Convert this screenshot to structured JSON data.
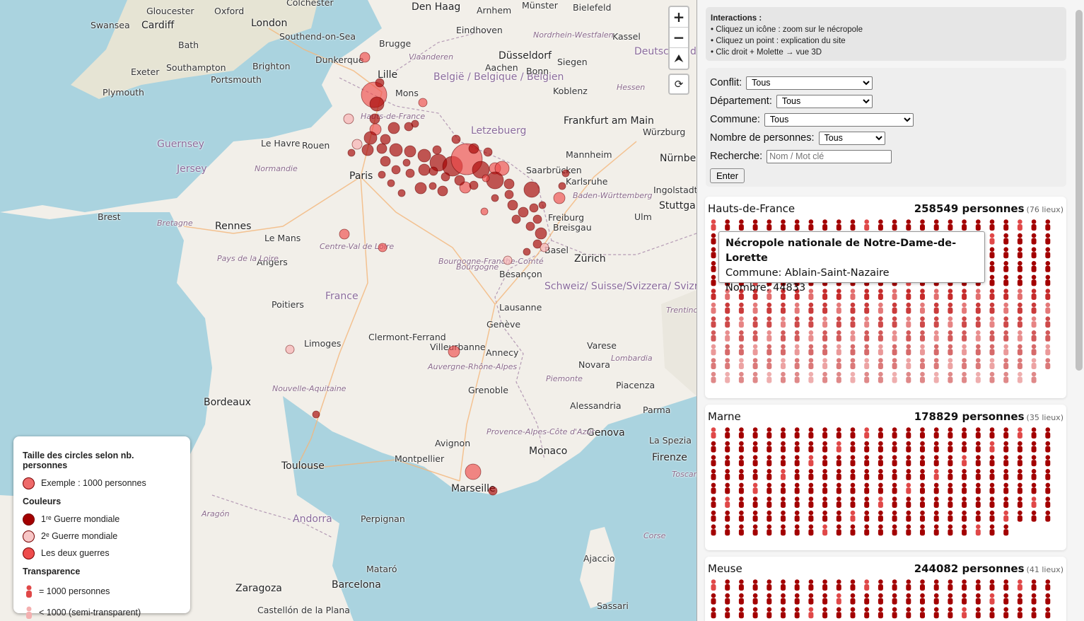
{
  "map": {
    "places": [
      {
        "name": "Gloucester",
        "cls": ""
      },
      {
        "name": "Oxford",
        "cls": ""
      },
      {
        "name": "Colchester",
        "cls": ""
      },
      {
        "name": "Swansea",
        "cls": ""
      },
      {
        "name": "Cardiff",
        "cls": "big"
      },
      {
        "name": "London",
        "cls": "big"
      },
      {
        "name": "Southend-on-Sea",
        "cls": ""
      },
      {
        "name": "Bath",
        "cls": ""
      },
      {
        "name": "Exeter",
        "cls": ""
      },
      {
        "name": "Southampton",
        "cls": ""
      },
      {
        "name": "Brighton",
        "cls": ""
      },
      {
        "name": "Portsmouth",
        "cls": ""
      },
      {
        "name": "Plymouth",
        "cls": ""
      },
      {
        "name": "Dunkerque",
        "cls": ""
      },
      {
        "name": "Lille",
        "cls": "big"
      },
      {
        "name": "Den Haag",
        "cls": "big"
      },
      {
        "name": "Arnhem",
        "cls": ""
      },
      {
        "name": "Münster",
        "cls": ""
      },
      {
        "name": "Bielefeld",
        "cls": ""
      },
      {
        "name": "Eindhoven",
        "cls": ""
      },
      {
        "name": "Brugge",
        "cls": ""
      },
      {
        "name": "Düsseldorf",
        "cls": "big"
      },
      {
        "name": "Kassel",
        "cls": ""
      },
      {
        "name": "Mons",
        "cls": ""
      },
      {
        "name": "België / Belgique / Belgien",
        "cls": "country"
      },
      {
        "name": "Aachen",
        "cls": ""
      },
      {
        "name": "Bonn",
        "cls": ""
      },
      {
        "name": "Siegen",
        "cls": ""
      },
      {
        "name": "Koblenz",
        "cls": ""
      },
      {
        "name": "Deutschland",
        "cls": "country"
      },
      {
        "name": "Letzebuerg",
        "cls": "country"
      },
      {
        "name": "Frankfurt am Main",
        "cls": "big"
      },
      {
        "name": "Würzburg",
        "cls": ""
      },
      {
        "name": "Guernsey",
        "cls": "country"
      },
      {
        "name": "Jersey",
        "cls": "country"
      },
      {
        "name": "Le Havre",
        "cls": ""
      },
      {
        "name": "Rouen",
        "cls": ""
      },
      {
        "name": "Normandie",
        "cls": "region"
      },
      {
        "name": "Paris",
        "cls": "big"
      },
      {
        "name": "Mannheim",
        "cls": ""
      },
      {
        "name": "Nürnberg",
        "cls": "big"
      },
      {
        "name": "Saarbrücken",
        "cls": ""
      },
      {
        "name": "Karlsruhe",
        "cls": ""
      },
      {
        "name": "Ingolstadt",
        "cls": ""
      },
      {
        "name": "Stuttgart",
        "cls": "big"
      },
      {
        "name": "Brest",
        "cls": ""
      },
      {
        "name": "Bretagne",
        "cls": "region"
      },
      {
        "name": "Rennes",
        "cls": "big"
      },
      {
        "name": "Le Mans",
        "cls": ""
      },
      {
        "name": "Baden-Württemberg",
        "cls": "region"
      },
      {
        "name": "Freiburg",
        "cls": ""
      },
      {
        "name": "Breisgau",
        "cls": ""
      },
      {
        "name": "Ulm",
        "cls": ""
      },
      {
        "name": "Centre-Val de Loire",
        "cls": "region"
      },
      {
        "name": "Angers",
        "cls": ""
      },
      {
        "name": "Pays de la Loire",
        "cls": "region"
      },
      {
        "name": "Basel",
        "cls": ""
      },
      {
        "name": "Zürich",
        "cls": "big"
      },
      {
        "name": "Bourgogne-Franche-Comté",
        "cls": "region"
      },
      {
        "name": "Besançon",
        "cls": ""
      },
      {
        "name": "France",
        "cls": "country"
      },
      {
        "name": "Schweiz/ Suisse/Svizzera/ Svizra",
        "cls": "country"
      },
      {
        "name": "Poitiers",
        "cls": ""
      },
      {
        "name": "Lausanne",
        "cls": ""
      },
      {
        "name": "Genève",
        "cls": ""
      },
      {
        "name": "Clermont-Ferrand",
        "cls": ""
      },
      {
        "name": "Limoges",
        "cls": ""
      },
      {
        "name": "Villeurbanne",
        "cls": ""
      },
      {
        "name": "Annecy",
        "cls": ""
      },
      {
        "name": "Varese",
        "cls": ""
      },
      {
        "name": "Novara",
        "cls": ""
      },
      {
        "name": "Lombardia",
        "cls": "region"
      },
      {
        "name": "Auvergne-Rhône-Alpes",
        "cls": "region"
      },
      {
        "name": "Nouvelle-Aquitaine",
        "cls": "region"
      },
      {
        "name": "Bordeaux",
        "cls": "big"
      },
      {
        "name": "Grenoble",
        "cls": ""
      },
      {
        "name": "Piemonte",
        "cls": "region"
      },
      {
        "name": "Piacenza",
        "cls": ""
      },
      {
        "name": "Alessandria",
        "cls": ""
      },
      {
        "name": "Parma",
        "cls": ""
      },
      {
        "name": "Genova",
        "cls": "big"
      },
      {
        "name": "La Spezia",
        "cls": ""
      },
      {
        "name": "Provence-Alpes-Côte d'Azur",
        "cls": "region"
      },
      {
        "name": "Avignon",
        "cls": ""
      },
      {
        "name": "Monaco",
        "cls": "big"
      },
      {
        "name": "Firenze",
        "cls": "big"
      },
      {
        "name": "Toulouse",
        "cls": "big"
      },
      {
        "name": "Montpellier",
        "cls": ""
      },
      {
        "name": "Marseille",
        "cls": "big"
      },
      {
        "name": "Toscana",
        "cls": "region"
      },
      {
        "name": "Andorra",
        "cls": "country"
      },
      {
        "name": "Perpignan",
        "cls": ""
      },
      {
        "name": "Aragón",
        "cls": "region"
      },
      {
        "name": "Ajaccio",
        "cls": ""
      },
      {
        "name": "Mataró",
        "cls": ""
      },
      {
        "name": "Barcelona",
        "cls": "big"
      },
      {
        "name": "Zaragoza",
        "cls": "big"
      },
      {
        "name": "Castellón de la Plana",
        "cls": ""
      },
      {
        "name": "Sassari",
        "cls": ""
      },
      {
        "name": "Trentino-Alto Adige",
        "cls": "region"
      },
      {
        "name": "Hessen",
        "cls": "region"
      },
      {
        "name": "Nordrhein-Westfalen",
        "cls": "region"
      },
      {
        "name": "Vlaanderen",
        "cls": "region"
      },
      {
        "name": "Bourgogne",
        "cls": "region"
      },
      {
        "name": "Hauts-de-France",
        "cls": "region"
      },
      {
        "name": "Corse",
        "cls": "region"
      }
    ]
  },
  "controls": {
    "zoom_in": "+",
    "zoom_out": "−",
    "compass": "⮝",
    "reset": "⟳"
  },
  "legend": {
    "title_size": "Taille des circles selon nb. personnes",
    "example": "Exemple : 1000 personnes",
    "title_colors": "Couleurs",
    "ww1": "1ʳᵉ Guerre mondiale",
    "ww2": "2ᵉ Guerre mondiale",
    "both": "Les deux guerres",
    "title_transp": "Transparence",
    "full": "= 1000 personnes",
    "semi": "< 1000 (semi-transparent)"
  },
  "info": {
    "title": "Interactions :",
    "lines": [
      "• Cliquez un icône : zoom sur le nécropole",
      "• Cliquez un point : explication du site",
      "• Clic droit + Molette → vue 3D"
    ]
  },
  "filters": {
    "conflit_label": "Conflit:",
    "conflit_value": "Tous",
    "dept_label": "Département:",
    "dept_value": "Tous",
    "commune_label": "Commune:",
    "commune_value": "Tous",
    "nombre_label": "Nombre de personnes:",
    "nombre_value": "Tous",
    "search_label": "Recherche:",
    "search_placeholder": "Nom / Mot clé",
    "enter": "Enter"
  },
  "cards": [
    {
      "name": "Hauts-de-France",
      "count": "258549 personnes",
      "lieux": "(76 lieux)"
    },
    {
      "name": "Marne",
      "count": "178829 personnes",
      "lieux": "(35 lieux)"
    },
    {
      "name": "Meuse",
      "count": "244082 personnes",
      "lieux": "(41 lieux)"
    }
  ],
  "tooltip": {
    "title": "Nécropole nationale de Notre-Dame-de-Lorette",
    "commune": "Commune: Ablain-Saint-Nazaire",
    "nombre": "Nombre: 44833"
  },
  "colors": {
    "ww1": "#a30000",
    "ww2": "#f7b7b7",
    "both": "#ee4c4c",
    "sea": "#aad3df",
    "land": "#f2efe9"
  }
}
